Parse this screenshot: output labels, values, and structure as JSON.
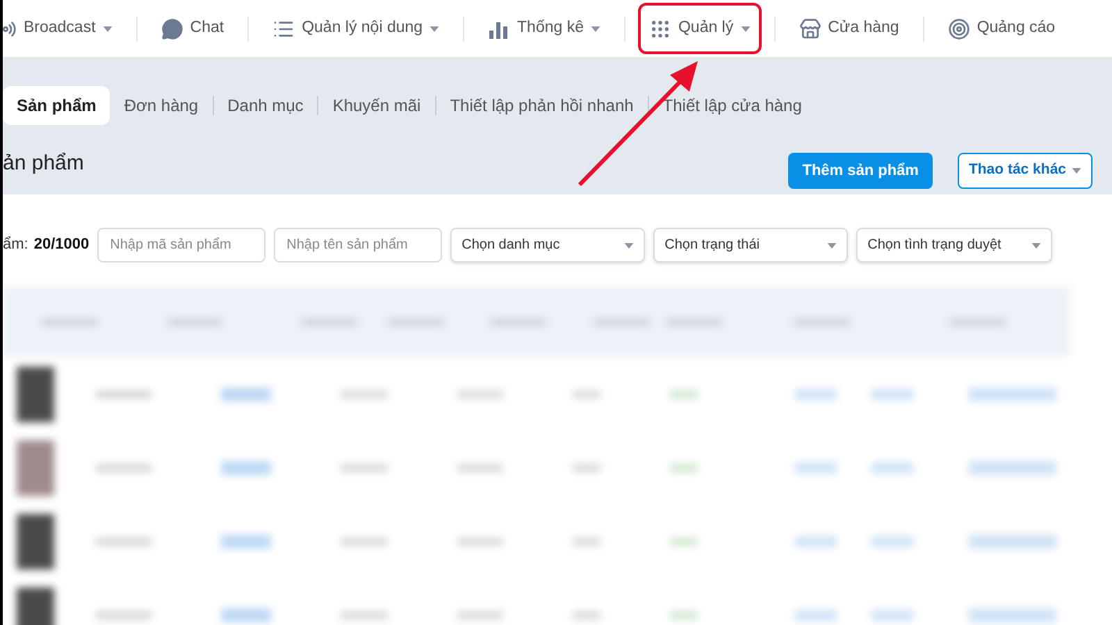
{
  "nav": [
    {
      "label": "Broadcast",
      "kind": "broadcast",
      "dropdown": true,
      "highlighted": false
    },
    {
      "label": "Chat",
      "kind": "chat",
      "dropdown": false,
      "highlighted": false
    },
    {
      "label": "Quản lý nội dung",
      "kind": "list",
      "dropdown": true,
      "highlighted": false
    },
    {
      "label": "Thống kê",
      "kind": "chart",
      "dropdown": true,
      "highlighted": false
    },
    {
      "label": "Quản lý",
      "kind": "grid",
      "dropdown": true,
      "highlighted": true
    },
    {
      "label": "Cửa hàng",
      "kind": "store",
      "dropdown": false,
      "highlighted": false
    },
    {
      "label": "Quảng cáo",
      "kind": "target",
      "dropdown": false,
      "highlighted": false
    }
  ],
  "tabs": [
    {
      "label": "Sản phẩm",
      "selected": true
    },
    {
      "label": "Đơn hàng",
      "selected": false
    },
    {
      "label": "Danh mục",
      "selected": false
    },
    {
      "label": "Khuyến mãi",
      "selected": false
    },
    {
      "label": "Thiết lập phản hồi nhanh",
      "selected": false
    },
    {
      "label": "Thiết lập cửa hàng",
      "selected": false
    }
  ],
  "page_title": "ản phẩm",
  "actions": {
    "primary": "Thêm sản phẩm",
    "secondary": "Thao tác khác"
  },
  "filters": {
    "count_label": "ẩm:",
    "count": "20/1000",
    "inputs": [
      {
        "placeholder": "Nhập mã sản phẩm"
      },
      {
        "placeholder": "Nhập tên sản phẩm"
      }
    ],
    "selects": [
      {
        "label": "Chọn danh mục"
      },
      {
        "label": "Chọn trạng thái"
      },
      {
        "label": "Chọn tình trạng duyệt"
      }
    ]
  }
}
